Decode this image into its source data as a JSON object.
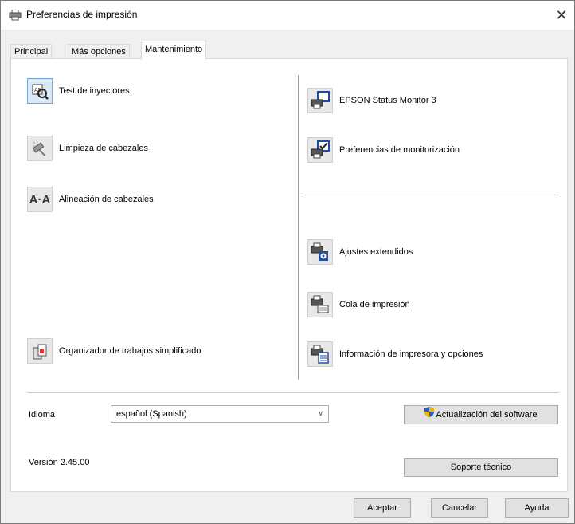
{
  "window": {
    "title": "Preferencias de impresión",
    "close_glyph": "✕"
  },
  "tabs": [
    {
      "label": "Principal"
    },
    {
      "label": "Más opciones"
    },
    {
      "label": "Mantenimiento"
    }
  ],
  "left_tools": [
    {
      "label": "Test de inyectores",
      "icon": "nozzle-check-icon"
    },
    {
      "label": "Limpieza de cabezales",
      "icon": "head-cleaning-icon"
    },
    {
      "label": "Alineación de cabezales",
      "icon": "head-alignment-icon"
    },
    {
      "label": "Organizador de trabajos simplificado",
      "icon": "job-arranger-icon"
    }
  ],
  "right_tools": [
    {
      "label": "EPSON Status Monitor 3",
      "icon": "status-monitor-icon"
    },
    {
      "label": "Preferencias de monitorización",
      "icon": "monitoring-preferences-icon"
    },
    {
      "label": "Ajustes extendidos",
      "icon": "extended-settings-icon"
    },
    {
      "label": "Cola de impresión",
      "icon": "print-queue-icon"
    },
    {
      "label": "Información de impresora y opciones",
      "icon": "printer-info-icon"
    }
  ],
  "alignment_icon_text": "A·A",
  "language": {
    "label": "Idioma",
    "value": "español (Spanish)"
  },
  "update_button": "Actualización del software",
  "version": "Versión 2.45.00",
  "support_button": "Soporte técnico",
  "footer": {
    "ok": "Aceptar",
    "cancel": "Cancelar",
    "help": "Ayuda"
  }
}
